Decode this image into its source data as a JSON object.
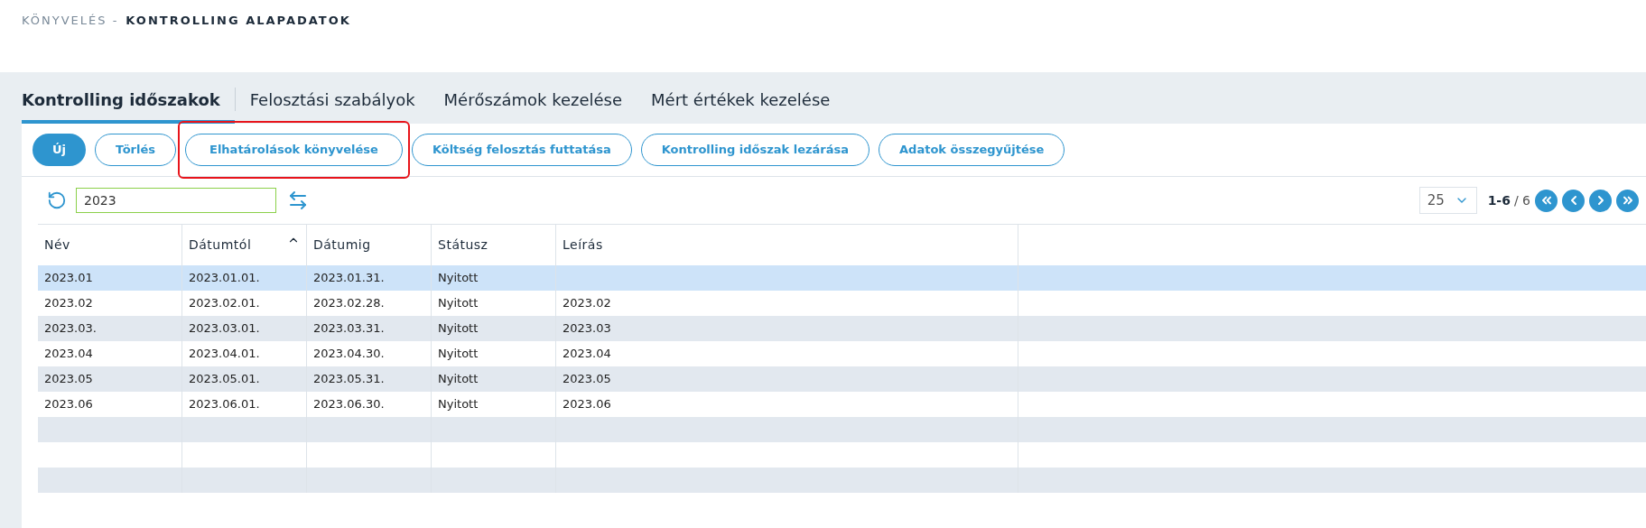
{
  "breadcrumb": {
    "parent": "KÖNYVELÉS -",
    "current": "KONTROLLING ALAPADATOK"
  },
  "tabs": [
    {
      "label": "Kontrolling időszakok",
      "selected": true
    },
    {
      "label": "Felosztási szabályok",
      "selected": false
    },
    {
      "label": "Mérőszámok kezelése",
      "selected": false
    },
    {
      "label": "Mért értékek kezelése",
      "selected": false
    }
  ],
  "actions": [
    {
      "label": "Új",
      "primary": true,
      "highlighted": false
    },
    {
      "label": "Törlés",
      "primary": false,
      "highlighted": false
    },
    {
      "label": "Elhatárolások könyvelése",
      "primary": false,
      "highlighted": true
    },
    {
      "label": "Költség felosztás futtatása",
      "primary": false,
      "highlighted": false
    },
    {
      "label": "Kontrolling időszak lezárása",
      "primary": false,
      "highlighted": false
    },
    {
      "label": "Adatok összegyűjtése",
      "primary": false,
      "highlighted": false
    }
  ],
  "filter": {
    "value": "2023"
  },
  "pagination": {
    "page_size": "25",
    "range": "1-6",
    "total": "/ 6"
  },
  "table": {
    "columns": [
      {
        "label": "Név",
        "sorted": false
      },
      {
        "label": "Dátumtól",
        "sorted": true
      },
      {
        "label": "Dátumig",
        "sorted": false
      },
      {
        "label": "Státusz",
        "sorted": false
      },
      {
        "label": "Leírás",
        "sorted": false
      }
    ],
    "rows": [
      {
        "cells": [
          "2023.01",
          "2023.01.01.",
          "2023.01.31.",
          "Nyitott",
          ""
        ],
        "selected": true
      },
      {
        "cells": [
          "2023.02",
          "2023.02.01.",
          "2023.02.28.",
          "Nyitott",
          "2023.02"
        ],
        "selected": false
      },
      {
        "cells": [
          "2023.03.",
          "2023.03.01.",
          "2023.03.31.",
          "Nyitott",
          "2023.03"
        ],
        "selected": false
      },
      {
        "cells": [
          "2023.04",
          "2023.04.01.",
          "2023.04.30.",
          "Nyitott",
          "2023.04"
        ],
        "selected": false
      },
      {
        "cells": [
          "2023.05",
          "2023.05.01.",
          "2023.05.31.",
          "Nyitott",
          "2023.05"
        ],
        "selected": false
      },
      {
        "cells": [
          "2023.06",
          "2023.06.01.",
          "2023.06.30.",
          "Nyitott",
          "2023.06"
        ],
        "selected": false
      }
    ]
  }
}
